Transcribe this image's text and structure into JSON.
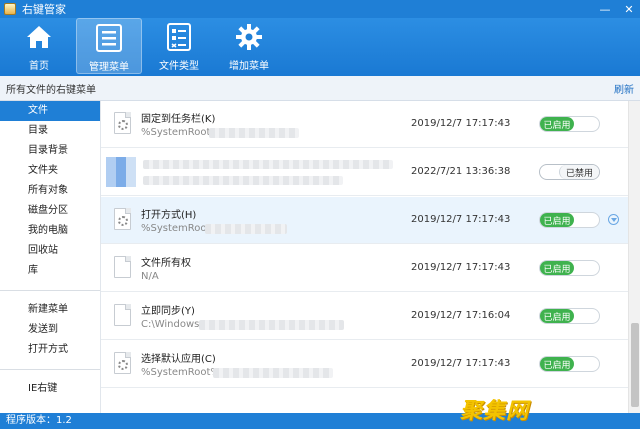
{
  "window": {
    "title": "右键管家",
    "minimize_glyph": "—",
    "close_glyph": "✕"
  },
  "toolbar": [
    {
      "label": "首页",
      "icon": "home-icon"
    },
    {
      "label": "管理菜单",
      "icon": "menu-list-icon",
      "active": true
    },
    {
      "label": "文件类型",
      "icon": "file-type-icon"
    },
    {
      "label": "增加菜单",
      "icon": "gear-icon"
    }
  ],
  "header": {
    "title": "所有文件的右键菜单",
    "refresh": "刷新"
  },
  "sidebar": {
    "group1": [
      "文件",
      "目录",
      "目录背景",
      "文件夹",
      "所有对象",
      "磁盘分区",
      "我的电脑",
      "回收站",
      "库"
    ],
    "group2": [
      "新建菜单",
      "发送到",
      "打开方式"
    ],
    "group3": [
      "IE右键"
    ]
  },
  "rows": [
    {
      "name": "固定到任务栏(K)",
      "path": "%SystemRoot",
      "date": "2019/12/7 17:17:43",
      "status": "已启用",
      "enabled": true
    },
    {
      "name": "",
      "path": "",
      "date": "2022/7/21 13:36:38",
      "status": "已禁用",
      "enabled": false
    },
    {
      "name": "打开方式(H)",
      "path": "%SystemRoot",
      "date": "2019/12/7 17:17:43",
      "status": "已启用",
      "enabled": true,
      "selected": true
    },
    {
      "name": "文件所有权",
      "path": "N/A",
      "date": "2019/12/7 17:17:43",
      "status": "已启用",
      "enabled": true
    },
    {
      "name": "立即同步(Y)",
      "path": "C:\\Windows",
      "date": "2019/12/7 17:16:04",
      "status": "已启用",
      "enabled": true
    },
    {
      "name": "选择默认应用(C)",
      "path": "%SystemRoot%",
      "date": "2019/12/7 17:17:43",
      "status": "已启用",
      "enabled": true
    }
  ],
  "status_bar": {
    "version": "程序版本：1.2"
  },
  "watermark": "聚集网",
  "colors": {
    "accent": "#1f7fd6",
    "enabled": "#3fb24e"
  }
}
